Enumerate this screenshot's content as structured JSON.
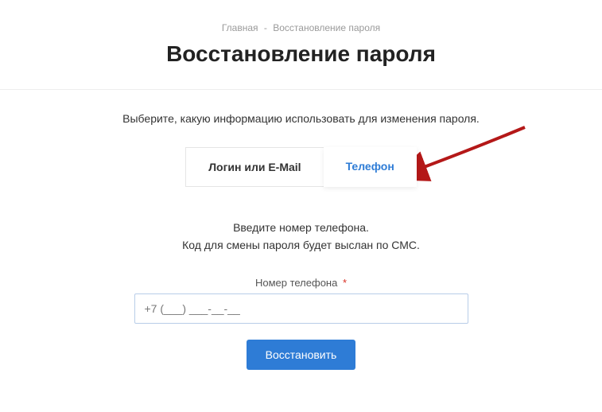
{
  "breadcrumb": {
    "home": "Главная",
    "separator": "-",
    "current": "Восстановление пароля"
  },
  "page_title": "Восстановление пароля",
  "instruction": "Выберите, какую информацию использовать для изменения пароля.",
  "tabs": {
    "login_email": "Логин или E-Mail",
    "phone": "Телефон"
  },
  "form": {
    "line1": "Введите номер телефона.",
    "line2": "Код для смены пароля будет выслан по СМС.",
    "field_label": "Номер телефона",
    "required_mark": "*",
    "phone_value": "+7 (___) ___-__-__",
    "submit_label": "Восстановить"
  },
  "colors": {
    "accent": "#2e7cd6",
    "arrow": "#b41818"
  }
}
